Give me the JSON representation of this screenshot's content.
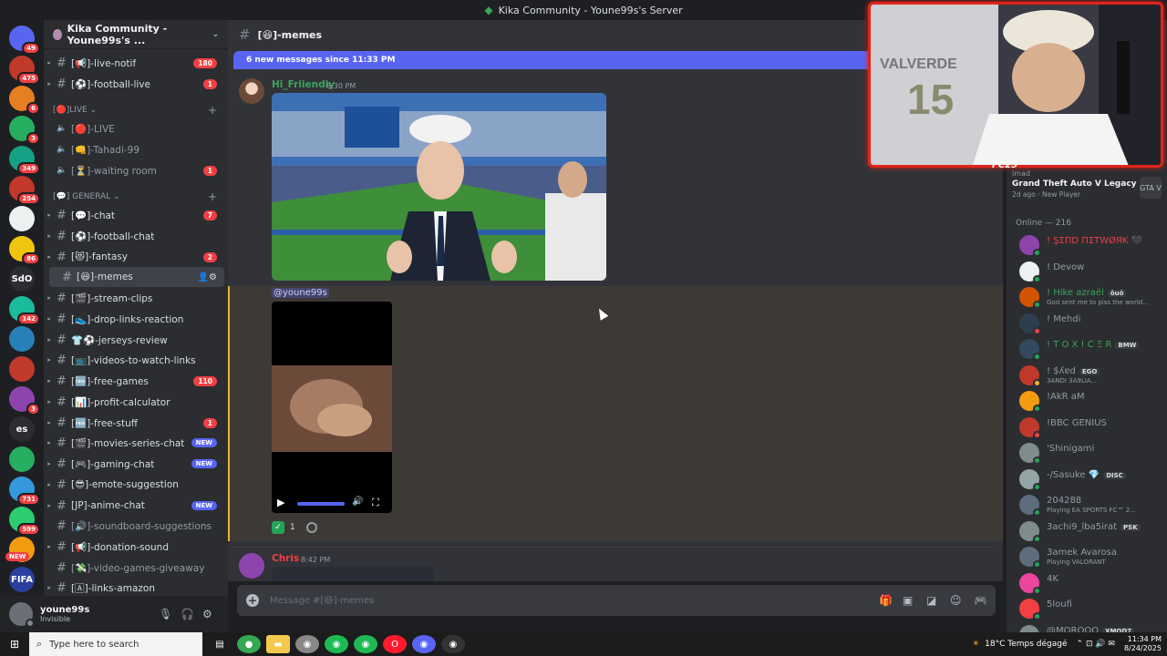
{
  "window": {
    "title": "Kika Community - Youne99s's Server"
  },
  "rail": {
    "servers": [
      {
        "badge": "49",
        "color": "#5865f2",
        "icon": "discord-icon"
      },
      {
        "badge": "475",
        "color": "#c0392b",
        "icon": "server-icon"
      },
      {
        "badge": "6",
        "color": "#e67e22",
        "icon": "server-icon"
      },
      {
        "badge": "3",
        "color": "#27ae60",
        "icon": "server-icon"
      },
      {
        "badge": "349",
        "color": "#16a085",
        "icon": "server-icon"
      },
      {
        "badge": "254",
        "color": "#c0392b",
        "icon": "server-icon"
      },
      {
        "badge": "",
        "color": "#ecf0f1",
        "icon": "server-icon"
      },
      {
        "badge": "86",
        "color": "#f1c40f",
        "icon": "server-icon"
      },
      {
        "badge": "",
        "color": "#2b2d31",
        "icon": "server-icon",
        "text": "SdO"
      },
      {
        "badge": "142",
        "color": "#1abc9c",
        "icon": "server-icon"
      },
      {
        "badge": "",
        "color": "#2980b9",
        "icon": "server-icon"
      },
      {
        "badge": "",
        "color": "#c0392b",
        "icon": "server-icon"
      },
      {
        "badge": "3",
        "color": "#8e44ad",
        "icon": "server-icon"
      },
      {
        "badge": "",
        "color": "#2b2d31",
        "icon": "server-icon",
        "text": "es"
      },
      {
        "badge": "",
        "color": "#27ae60",
        "icon": "server-icon"
      },
      {
        "badge": "731",
        "color": "#3498db",
        "icon": "server-icon"
      },
      {
        "badge": "599",
        "color": "#2ecc71",
        "icon": "server-icon"
      },
      {
        "badge": "",
        "color": "#f39c12",
        "icon": "server-icon"
      },
      {
        "badge": "",
        "color": "#2c3e9e",
        "icon": "server-icon",
        "text": "FIFA"
      }
    ],
    "new_label": "NEW"
  },
  "sidebar": {
    "server_name": "Kika Community - Youne99s's ...",
    "channels": [
      {
        "name": "[📢]-live-notif",
        "badge": "180",
        "type": "text",
        "unread": true
      },
      {
        "name": "[⚽]-football-live",
        "badge": "1",
        "type": "text",
        "unread": true
      },
      {
        "name": "[🔴]-LIVE",
        "badge": "",
        "type": "voice",
        "unread": false
      },
      {
        "name": "[👊]-Tahadi-99",
        "badge": "",
        "type": "voice",
        "unread": false
      },
      {
        "name": "[⏳]-waiting room",
        "badge": "1",
        "type": "voice",
        "unread": false
      },
      {
        "name": "[💬]-chat",
        "badge": "7",
        "type": "text",
        "unread": true
      },
      {
        "name": "[⚽]-football-chat",
        "badge": "",
        "type": "text",
        "unread": true
      },
      {
        "name": "[😻]-fantasy",
        "badge": "2",
        "type": "text",
        "unread": true
      },
      {
        "name": "[😆]-memes",
        "badge": "",
        "type": "text",
        "unread": true,
        "active": true
      },
      {
        "name": "[🎬]-stream-clips",
        "badge": "",
        "type": "text",
        "unread": true
      },
      {
        "name": "[👟]-drop-links-reaction",
        "badge": "",
        "type": "text",
        "unread": true
      },
      {
        "name": "👕⚽-jerseys-review",
        "badge": "",
        "type": "text",
        "unread": true
      },
      {
        "name": "[📺]-videos-to-watch-links",
        "badge": "",
        "type": "text",
        "unread": true
      },
      {
        "name": "[🆓]-free-games",
        "badge": "110",
        "type": "text",
        "unread": true
      },
      {
        "name": "[📊]-profit-calculator",
        "badge": "",
        "type": "text",
        "unread": true
      },
      {
        "name": "[🆓]-free-stuff",
        "badge": "1",
        "type": "text",
        "unread": true
      },
      {
        "name": "[🎬]-movies-series-chat",
        "badge": "NEW",
        "type": "text",
        "unread": true
      },
      {
        "name": "[🎮]-gaming-chat",
        "badge": "NEW",
        "type": "text",
        "unread": true
      },
      {
        "name": "[😎]-emote-suggestion",
        "badge": "",
        "type": "text",
        "unread": true
      },
      {
        "name": "[JP]-anime-chat",
        "badge": "NEW",
        "type": "text",
        "unread": true
      },
      {
        "name": "[🔊]-soundboard-suggestions",
        "badge": "",
        "type": "text",
        "unread": false
      },
      {
        "name": "[📢]-donation-sound",
        "badge": "",
        "type": "text",
        "unread": true
      },
      {
        "name": "[💸]-video-games-giveaway",
        "badge": "",
        "type": "text",
        "unread": false
      },
      {
        "name": "[🄰]-links-amazon",
        "badge": "",
        "type": "text",
        "unread": true
      }
    ],
    "categories": [
      {
        "label": "[🔴]LIVE ⌄"
      },
      {
        "label": "[💬] GENERAL ⌄"
      }
    ]
  },
  "user": {
    "name": "youne99s",
    "status": "Invisible"
  },
  "chat": {
    "channel_title": "[😆]-memes",
    "new_messages_bar": "6 new messages since 11:33 PM",
    "messages": [
      {
        "author": "Hi_Friiendly",
        "time": "8:30 PM",
        "author_color": "#3ba55c"
      },
      {
        "author": "Chris",
        "time": "8:42 PM",
        "author_color": "#f23f43"
      }
    ],
    "mention": "@youne99s",
    "reaction_count": "1",
    "input_placeholder": "Message #[😆]-memes"
  },
  "members": {
    "activity": {
      "small": "imad",
      "game": "Grand Theft Auto V Legacy",
      "sub": "2d ago · New Player",
      "icon_label": "GTA V"
    },
    "online_header": "Online — 216",
    "list": [
      {
        "name": "! ŞΣΠD ΠΣTWØЯK 🖤",
        "sub": "",
        "name_color": "#f23f43",
        "dot": "#23a559",
        "avatar": "#8e44ad"
      },
      {
        "name": "! Devow",
        "sub": "",
        "name_color": "#949ba4",
        "dot": "#23a559",
        "avatar": "#ecf0f1"
      },
      {
        "name": "! Hike azraël",
        "sub": "God sent me to piss the world...",
        "name_color": "#3ba55c",
        "dot": "#23a559",
        "avatar": "#d35400",
        "tag": "ôuô"
      },
      {
        "name": "! Mehdi",
        "sub": "",
        "name_color": "#949ba4",
        "dot": "#f23f43",
        "avatar": "#2c3e50"
      },
      {
        "name": "! T O X ! C Ξ R",
        "sub": "",
        "name_color": "#3ba55c",
        "dot": "#23a559",
        "avatar": "#34495e",
        "tag": "BMW"
      },
      {
        "name": "! $ʎɐd",
        "sub": "3ANDI 3A9LIA...",
        "name_color": "#949ba4",
        "dot": "#f0b232",
        "avatar": "#c0392b",
        "tag": "EGO"
      },
      {
        "name": "!AkR aM",
        "sub": "",
        "name_color": "#949ba4",
        "dot": "#23a559",
        "avatar": "#f39c12"
      },
      {
        "name": "!BBC GENIUS",
        "sub": "",
        "name_color": "#949ba4",
        "dot": "#f23f43",
        "avatar": "#c0392b"
      },
      {
        "name": "'Shinigami",
        "sub": "",
        "name_color": "#949ba4",
        "dot": "#23a559",
        "avatar": "#7f8c8d"
      },
      {
        "name": "-/Sasuke 💎",
        "sub": "",
        "name_color": "#949ba4",
        "dot": "#23a559",
        "avatar": "#95a5a6",
        "tag": "DISC"
      },
      {
        "name": "204288",
        "sub": "Playing EA SPORTS FC™ 2...",
        "name_color": "#949ba4",
        "dot": "#23a559",
        "avatar": "#5d6d7e"
      },
      {
        "name": "3achi9_lba5irat",
        "sub": "",
        "name_color": "#949ba4",
        "dot": "#23a559",
        "avatar": "#7f8c8d",
        "tag": "PSK"
      },
      {
        "name": "3amek Avarosa",
        "sub": "Playing VALORANT",
        "name_color": "#949ba4",
        "dot": "#23a559",
        "avatar": "#5d6d7e"
      },
      {
        "name": "4K",
        "sub": "",
        "name_color": "#949ba4",
        "dot": "#23a559",
        "avatar": "#eb459e"
      },
      {
        "name": "5loufi",
        "sub": "",
        "name_color": "#949ba4",
        "dot": "#23a559",
        "avatar": "#f23f43"
      },
      {
        "name": "@MOROOO",
        "sub": "",
        "name_color": "#949ba4",
        "dot": "#23a559",
        "avatar": "#7f8c8d",
        "tag": "XMOD7"
      }
    ]
  },
  "webcam": {
    "overlay": "FC25",
    "jersey_name": "VALVERDE",
    "jersey_number": "15"
  },
  "taskbar": {
    "search_placeholder": "Type here to search",
    "weather": "18°C  Temps dégagé",
    "time": "11:34 PM",
    "date": "8/24/2025"
  }
}
